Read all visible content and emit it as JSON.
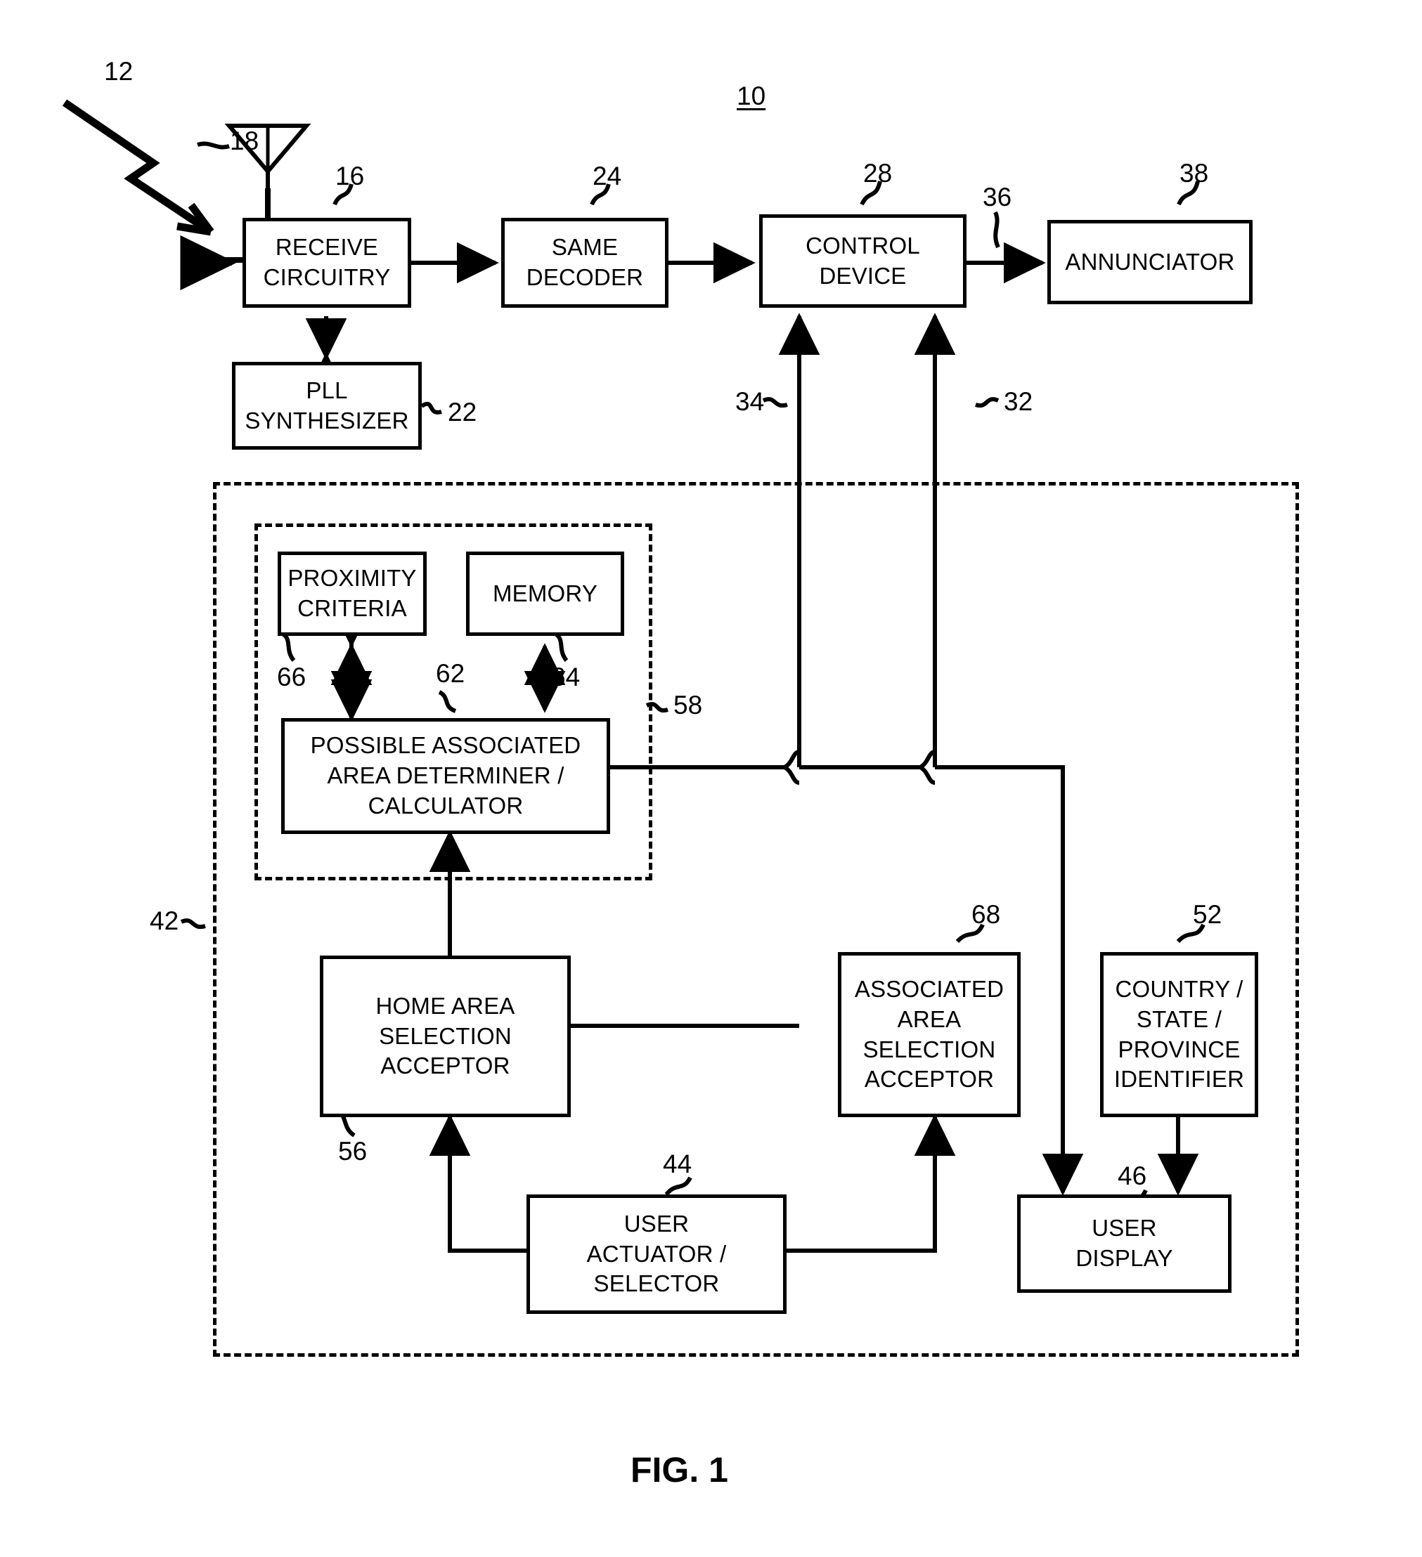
{
  "figure": {
    "caption": "FIG. 1",
    "system_ref": "10"
  },
  "blocks": [
    {
      "id": "receive-circuitry",
      "label": "RECEIVE\nCIRCUITRY",
      "ref": "16"
    },
    {
      "id": "same-decoder",
      "label": "SAME\nDECODER",
      "ref": "24"
    },
    {
      "id": "control-device",
      "label": "CONTROL\nDEVICE",
      "ref": "28"
    },
    {
      "id": "annunciator",
      "label": "ANNUNCIATOR",
      "ref": "38"
    },
    {
      "id": "pll-synthesizer",
      "label": "PLL\nSYNTHESIZER",
      "ref": "22"
    },
    {
      "id": "proximity-criteria",
      "label": "PROXIMITY\nCRITERIA",
      "ref": "66"
    },
    {
      "id": "memory",
      "label": "MEMORY",
      "ref": "64"
    },
    {
      "id": "area-determiner",
      "label": "POSSIBLE ASSOCIATED\nAREA DETERMINER /\nCALCULATOR",
      "ref": "62"
    },
    {
      "id": "home-area-acceptor",
      "label": "HOME AREA\nSELECTION\nACCEPTOR",
      "ref": "56"
    },
    {
      "id": "associated-area-acceptor",
      "label": "ASSOCIATED\nAREA\nSELECTION\nACCEPTOR",
      "ref": "68"
    },
    {
      "id": "country-state-province-identifier",
      "label": "COUNTRY /\nSTATE /\nPROVINCE\nIDENTIFIER",
      "ref": "52"
    },
    {
      "id": "user-actuator",
      "label": "USER\nACTUATOR /\nSELECTOR",
      "ref": "44"
    },
    {
      "id": "user-display",
      "label": "USER\nDISPLAY",
      "ref": "46"
    }
  ],
  "refs": {
    "incoming_signal": "12",
    "antenna": "18",
    "receive_circuitry": "16",
    "same_decoder": "24",
    "control_device": "28",
    "annunciator_link": "36",
    "annunciator": "38",
    "pll_synthesizer": "22",
    "signal_34": "34",
    "signal_32": "32",
    "outer_container": "42",
    "inner_container": "58",
    "proximity_criteria": "66",
    "area_determiner": "62",
    "memory": "64",
    "home_area_acceptor": "56",
    "associated_area_acceptor": "68",
    "country_identifier": "52",
    "user_actuator": "44",
    "user_display": "46",
    "system": "10"
  },
  "labels": {
    "receive_circuitry": "RECEIVE\nCIRCUITRY",
    "same_decoder": "SAME\nDECODER",
    "control_device": "CONTROL\nDEVICE",
    "annunciator": "ANNUNCIATOR",
    "pll_synthesizer": "PLL\nSYNTHESIZER",
    "proximity_criteria": "PROXIMITY\nCRITERIA",
    "memory": "MEMORY",
    "area_determiner": "POSSIBLE ASSOCIATED\nAREA DETERMINER /\nCALCULATOR",
    "home_area_acceptor": "HOME AREA\nSELECTION\nACCEPTOR",
    "associated_area_acceptor": "ASSOCIATED\nAREA\nSELECTION\nACCEPTOR",
    "country_identifier": "COUNTRY /\nSTATE /\nPROVINCE\nIDENTIFIER",
    "user_actuator": "USER\nACTUATOR /\nSELECTOR",
    "user_display": "USER\nDISPLAY"
  },
  "colors": {
    "ink": "#000000",
    "paper": "#ffffff"
  }
}
